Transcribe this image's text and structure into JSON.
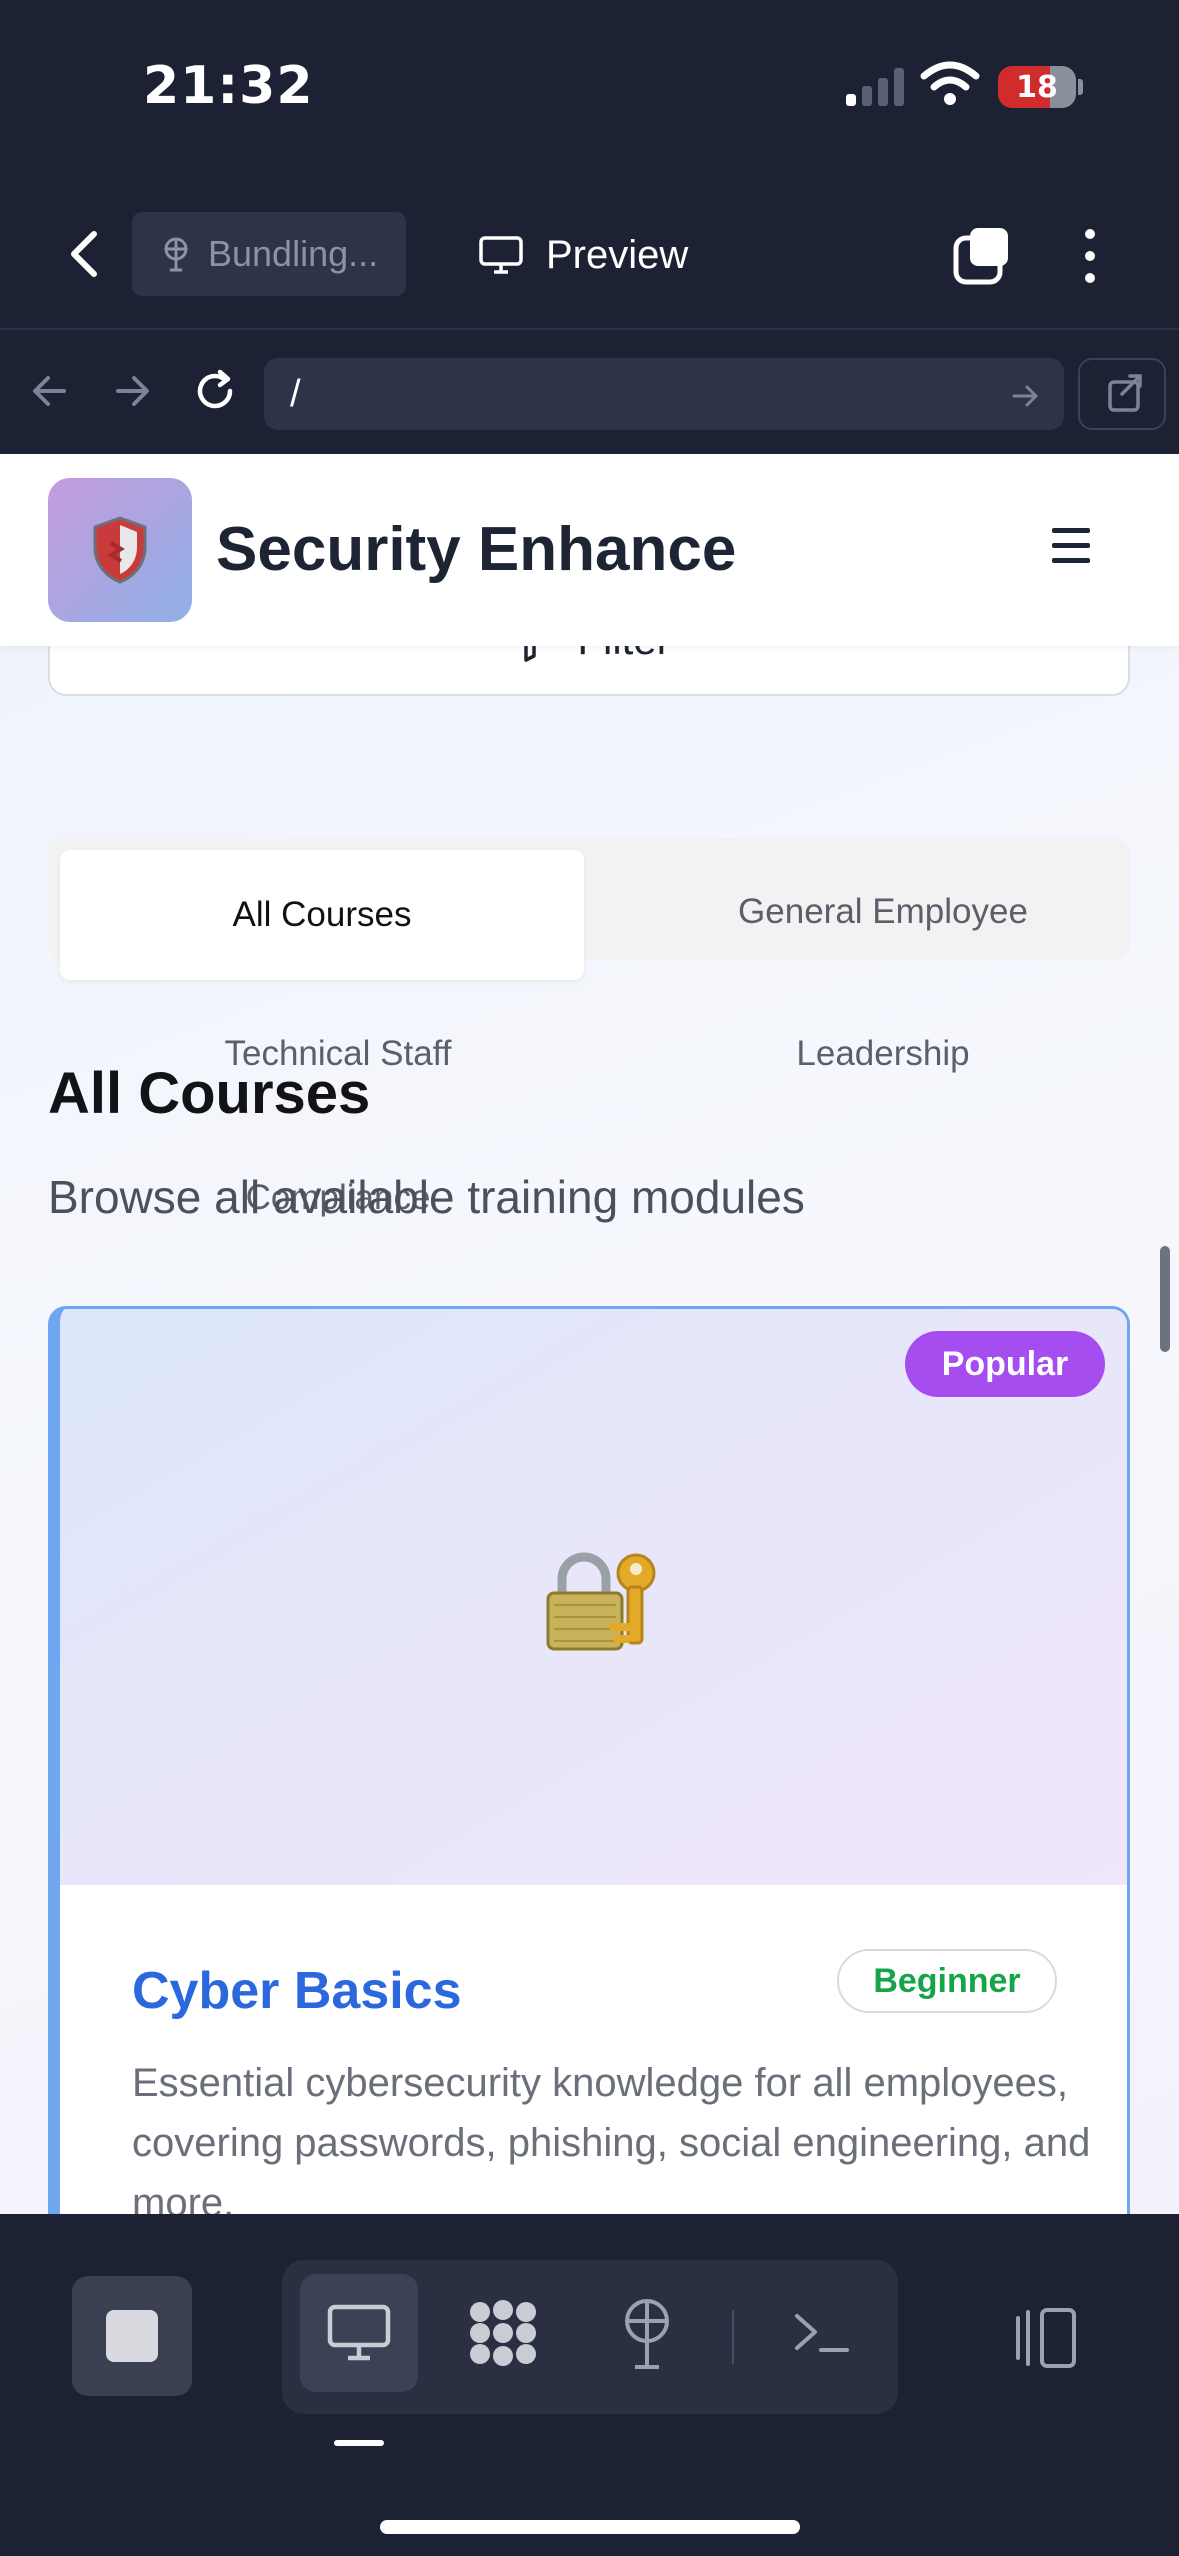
{
  "status_bar": {
    "time": "21:32",
    "battery": "18"
  },
  "app_toolbar": {
    "bundling_label": "Bundling...",
    "preview_label": "Preview"
  },
  "url_bar": {
    "url": "/"
  },
  "site": {
    "title": "Security Enhance",
    "filter_label": "Filter"
  },
  "category_tabs": [
    {
      "label": "All Courses",
      "active": true
    },
    {
      "label": "General Employee",
      "active": false
    },
    {
      "label": "Technical Staff",
      "active": false
    },
    {
      "label": "Leadership",
      "active": false
    },
    {
      "label": "Compliance",
      "active": false
    }
  ],
  "section": {
    "title": "All Courses",
    "subtitle": "Browse all available training modules"
  },
  "course_card": {
    "badge": "Popular",
    "icon": "lock-with-key-icon",
    "title": "Cyber Basics",
    "level": "Beginner",
    "description": "Essential cybersecurity knowledge for all employees, covering passwords, phishing, social engineering, and more."
  },
  "colors": {
    "chrome_bg": "#1c2133",
    "brand_title": "#2b68dd",
    "popular_badge": "#a64df0",
    "level_text": "#17a34a",
    "card_accent": "#6ea6f0"
  }
}
